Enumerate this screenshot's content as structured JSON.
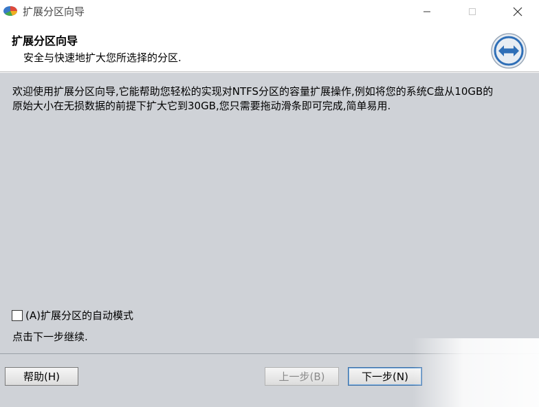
{
  "window": {
    "title": "扩展分区向导",
    "icon": "partition-app-icon"
  },
  "header": {
    "title": "扩展分区向导",
    "subtitle": "安全与快速地扩大您所选择的分区.",
    "icon": "expand-arrows-icon"
  },
  "content": {
    "description": "欢迎使用扩展分区向导,它能帮助您轻松的实现对NTFS分区的容量扩展操作,例如将您的系统C盘从10GB的原始大小在无损数据的前提下扩大它到30GB,您只需要拖动滑条即可完成,简单易用.",
    "auto_mode_checkbox_label": "(A)扩展分区的自动模式",
    "auto_mode_checked": false,
    "continue_note": "点击下一步继续."
  },
  "buttons": {
    "help": "帮助(H)",
    "prev": "上一步(B)",
    "next": "下一步(N)"
  },
  "colors": {
    "content_bg": "#cfd2d7",
    "icon_blue": "#2f6fb7"
  }
}
